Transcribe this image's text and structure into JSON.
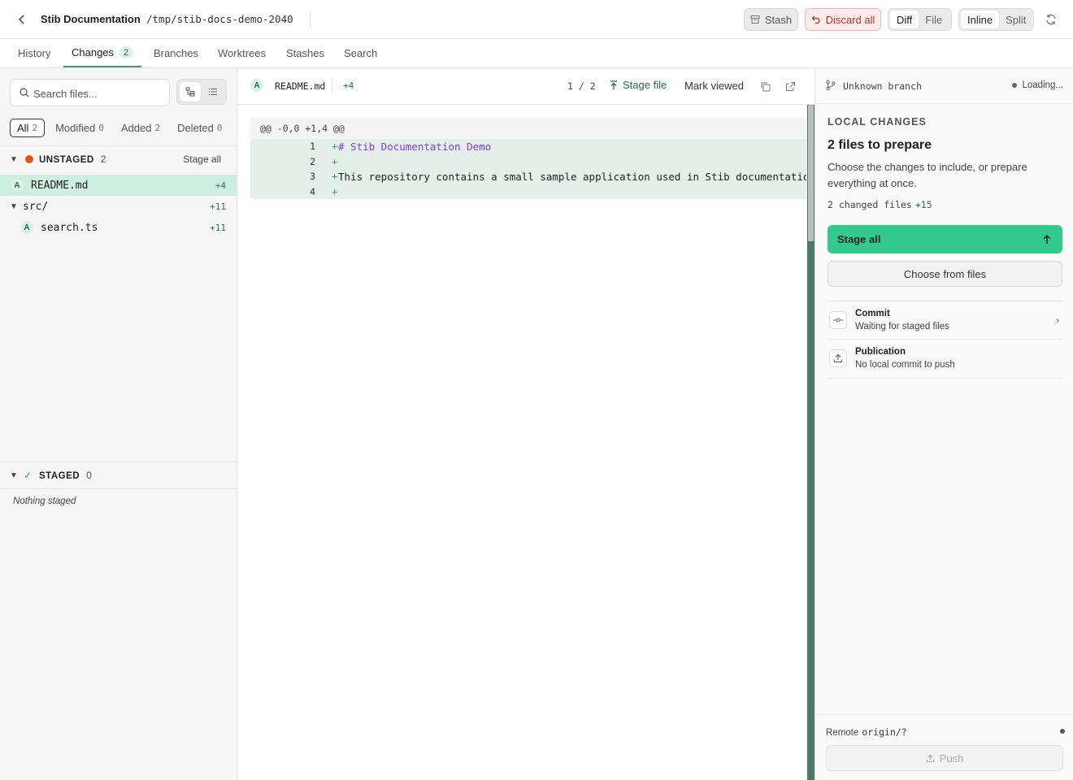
{
  "header": {
    "repo_name": "Stib Documentation",
    "repo_path": "/tmp/stib-docs-demo-2040",
    "stash_label": "Stash",
    "discard_label": "Discard all",
    "diff_mode": [
      "Diff",
      "File"
    ],
    "view_mode": [
      "Inline",
      "Split"
    ],
    "active_diff_mode": "Diff",
    "active_view_mode": "Inline"
  },
  "tabs": [
    {
      "label": "History"
    },
    {
      "label": "Changes",
      "badge": "2"
    },
    {
      "label": "Branches"
    },
    {
      "label": "Worktrees"
    },
    {
      "label": "Stashes"
    },
    {
      "label": "Search"
    }
  ],
  "sidebar": {
    "search_placeholder": "Search files...",
    "filters": [
      {
        "label": "All",
        "count": "2"
      },
      {
        "label": "Modified",
        "count": "0"
      },
      {
        "label": "Added",
        "count": "2"
      },
      {
        "label": "Deleted",
        "count": "0"
      }
    ],
    "unstaged": {
      "title": "UNSTAGED",
      "count": "2",
      "stage_all": "Stage all",
      "files": [
        {
          "status": "A",
          "name": "README.md",
          "additions": "+4"
        },
        {
          "folder": "src/",
          "additions": "+11"
        },
        {
          "status": "A",
          "name": "search.ts",
          "additions": "+11"
        }
      ]
    },
    "staged": {
      "title": "STAGED",
      "count": "0",
      "empty_text": "Nothing staged"
    }
  },
  "diff": {
    "status": "A",
    "file_name": "README.md",
    "additions": "+4",
    "page": "1 / 2",
    "stage_file": "Stage file",
    "mark_viewed": "Mark viewed",
    "hunk_header": "@@ -0,0 +1,4 @@",
    "lines": [
      {
        "num": "1",
        "sign": "+",
        "text": "# Stib Documentation Demo"
      },
      {
        "num": "2",
        "sign": "+",
        "text": ""
      },
      {
        "num": "3",
        "sign": "+",
        "text": "This repository contains a small sample application used in Stib documentation s"
      },
      {
        "num": "4",
        "sign": "+",
        "text": ""
      }
    ]
  },
  "right": {
    "branch": "Unknown branch",
    "loading": "Loading...",
    "section_label": "LOCAL CHANGES",
    "title": "2 files to prepare",
    "description": "Choose the changes to include, or prepare everything at once.",
    "changed_files": "2 changed files",
    "changed_additions": "+15",
    "stage_all": "Stage all",
    "choose_files": "Choose from files",
    "commit_title": "Commit",
    "commit_sub": "Waiting for staged files",
    "publication_title": "Publication",
    "publication_sub": "No local commit to push",
    "remote_label": "Remote",
    "remote_value": "origin/?",
    "push_label": "Push"
  },
  "colors": {
    "accent": "#33c98e",
    "selected_row": "#cdeee0",
    "added_line_bg": "#e4efe9",
    "danger": "#cf2b2b",
    "unstaged_dot": "#e0571a"
  }
}
